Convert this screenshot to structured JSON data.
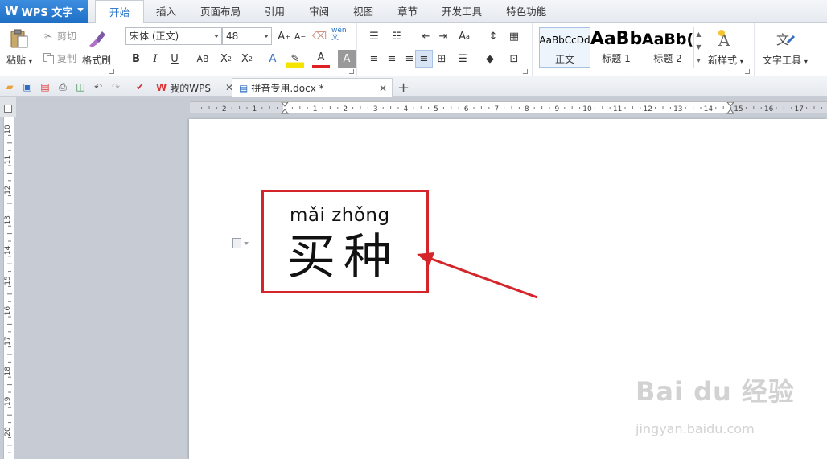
{
  "app": {
    "name": "WPS 文字"
  },
  "menu": {
    "tabs": [
      "开始",
      "插入",
      "页面布局",
      "引用",
      "审阅",
      "视图",
      "章节",
      "开发工具",
      "特色功能"
    ],
    "active": 0
  },
  "ribbon": {
    "paste": "粘贴",
    "cut": "剪切",
    "copy": "复制",
    "format_painter": "格式刷",
    "font_name": "宋体 (正文)",
    "font_size": "48",
    "styles": [
      {
        "preview": "AaBbCcDd",
        "label": "正文"
      },
      {
        "preview": "AaBb",
        "label": "标题 1"
      },
      {
        "preview": "AaBb(",
        "label": "标题 2"
      }
    ],
    "new_style": "新样式",
    "text_tools": "文字工具",
    "pinyin_icon_text": "wén 文"
  },
  "doc_tabs": [
    {
      "label": "我的WPS",
      "active": false
    },
    {
      "label": "拼音专用.docx *",
      "active": true
    }
  ],
  "ruler": {
    "h_labels": [
      "2",
      "1",
      "1",
      "2",
      "3",
      "4",
      "5",
      "6",
      "7",
      "8",
      "9",
      "10",
      "11",
      "12",
      "13",
      "14",
      "15",
      "16",
      "17"
    ],
    "v_labels": [
      "10",
      "11",
      "12",
      "13",
      "14",
      "15",
      "16",
      "17",
      "18",
      "19",
      "20"
    ]
  },
  "document": {
    "pinyin": "mǎi zhǒng",
    "hanzi": "买种"
  },
  "annotation": {
    "box_color": "#d4252b",
    "arrow_color": "#d4252b"
  },
  "watermark": {
    "logo": "Bai du 经验",
    "url": "jingyan.baidu.com"
  },
  "colors": {
    "brand": "#1f6fc5",
    "page": "#ffffff",
    "workspace": "#c7ccd4"
  }
}
